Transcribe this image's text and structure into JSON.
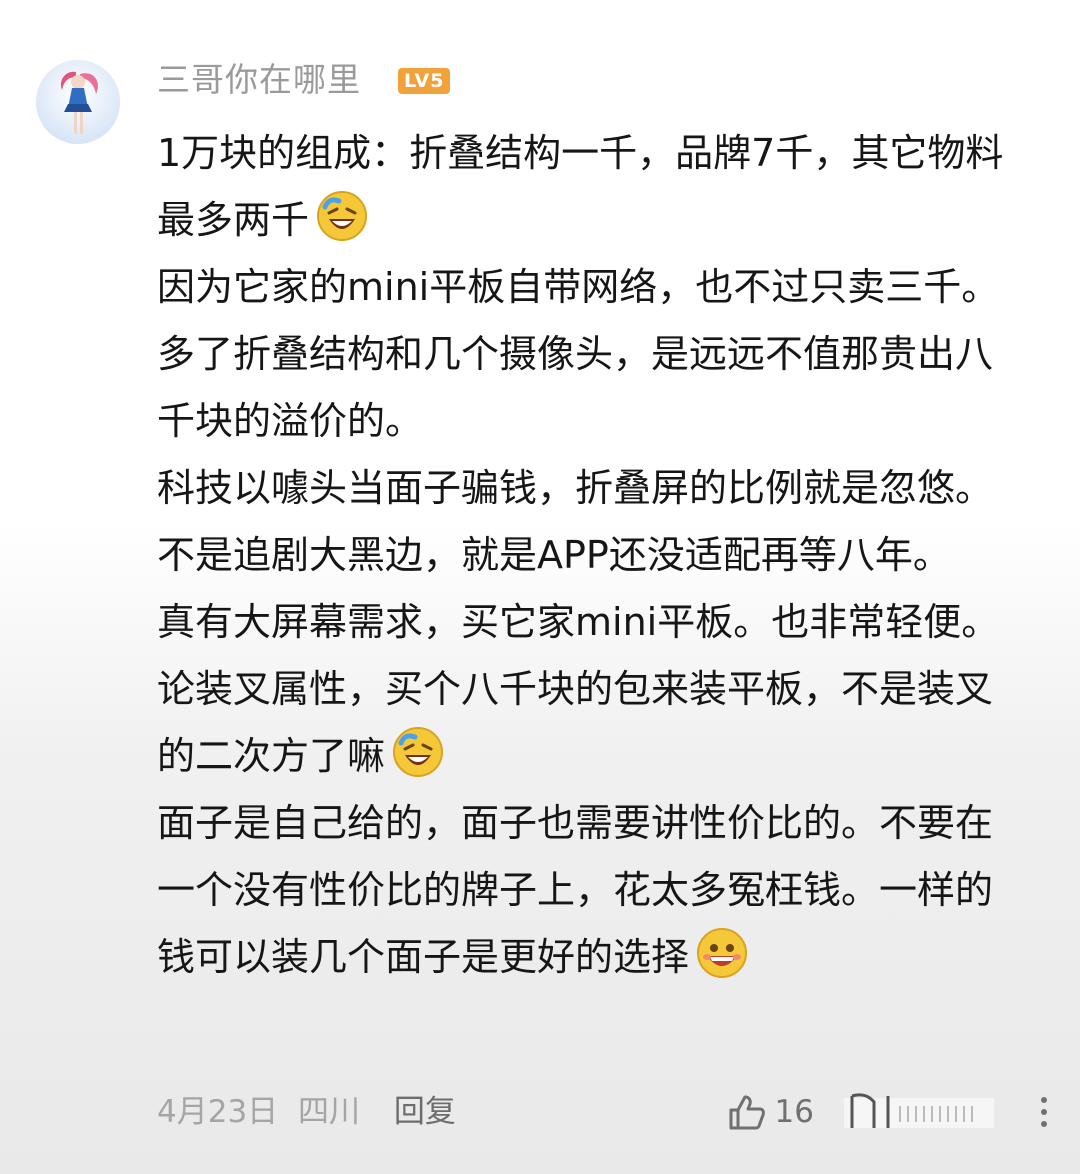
{
  "user": {
    "name": "三哥你在哪里",
    "level": "LV5"
  },
  "comment": {
    "paragraphs": [
      {
        "text": "1万块的组成：折叠结构一千，品牌7千，其它物料最多两千",
        "emoji": "laughing-crying-emoji"
      },
      {
        "text": "因为它家的mini平板自带网络，也不过只卖三千。多了折叠结构和几个摄像头，是远远不值那贵出八千块的溢价的。"
      },
      {
        "text": "科技以噱头当面子骗钱，折叠屏的比例就是忽悠。不是追剧大黑边，就是APP还没适配再等八年。"
      },
      {
        "text": "真有大屏幕需求，买它家mini平板。也非常轻便。论装叉属性，买个八千块的包来装平板，不是装叉的二次方了嘛",
        "emoji": "laughing-crying-emoji"
      },
      {
        "text": "面子是自己给的，面子也需要讲性价比的。不要在一个没有性价比的牌子上，花太多冤枉钱。一样的钱可以装几个面子是更好的选择",
        "emoji": "grinning-face-emoji"
      }
    ]
  },
  "footer": {
    "date": "4月23日",
    "location": "四川",
    "reply": "回复",
    "likes": "16"
  },
  "icons": {
    "like": "thumbs-up-icon",
    "more": "more-vertical-icon",
    "watermark": "watermark-logo"
  },
  "colors": {
    "level_badge": "#f2a23a",
    "emoji_yellow": "#f5c83a"
  }
}
